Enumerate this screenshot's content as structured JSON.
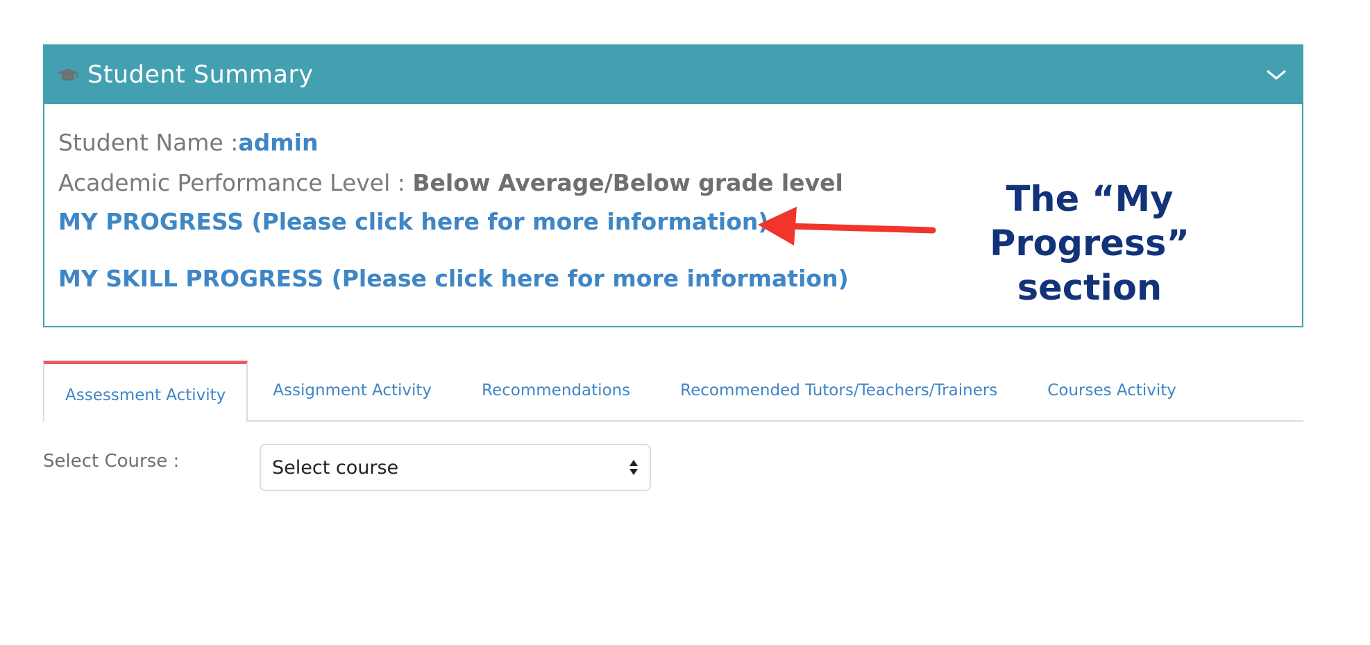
{
  "summary": {
    "title": "Student Summary",
    "student_name_label": "Student Name :",
    "student_name_value": "admin",
    "performance_label": "Academic Performance Level : ",
    "performance_value": "Below Average/Below grade level",
    "my_progress_link": "MY PROGRESS (Please click here for more information)",
    "my_skill_progress_link": "MY SKILL PROGRESS (Please click here for more information)",
    "icons": {
      "header": "graduation-cap-icon",
      "toggle": "chevron-down-icon"
    }
  },
  "annotation": {
    "text": "The “My Progress” section",
    "arrow_color": "#f1352b",
    "text_color": "#12337a"
  },
  "tabs": [
    {
      "label": "Assessment Activity",
      "active": true
    },
    {
      "label": "Assignment Activity",
      "active": false
    },
    {
      "label": "Recommendations",
      "active": false
    },
    {
      "label": "Recommended Tutors/Teachers/Trainers",
      "active": false
    },
    {
      "label": "Courses Activity",
      "active": false
    }
  ],
  "course_select": {
    "label": "Select Course :",
    "selected": "Select course"
  },
  "colors": {
    "header_bg": "#43a0b1",
    "link": "#3f86c6",
    "active_tab_accent": "#e85d64"
  }
}
